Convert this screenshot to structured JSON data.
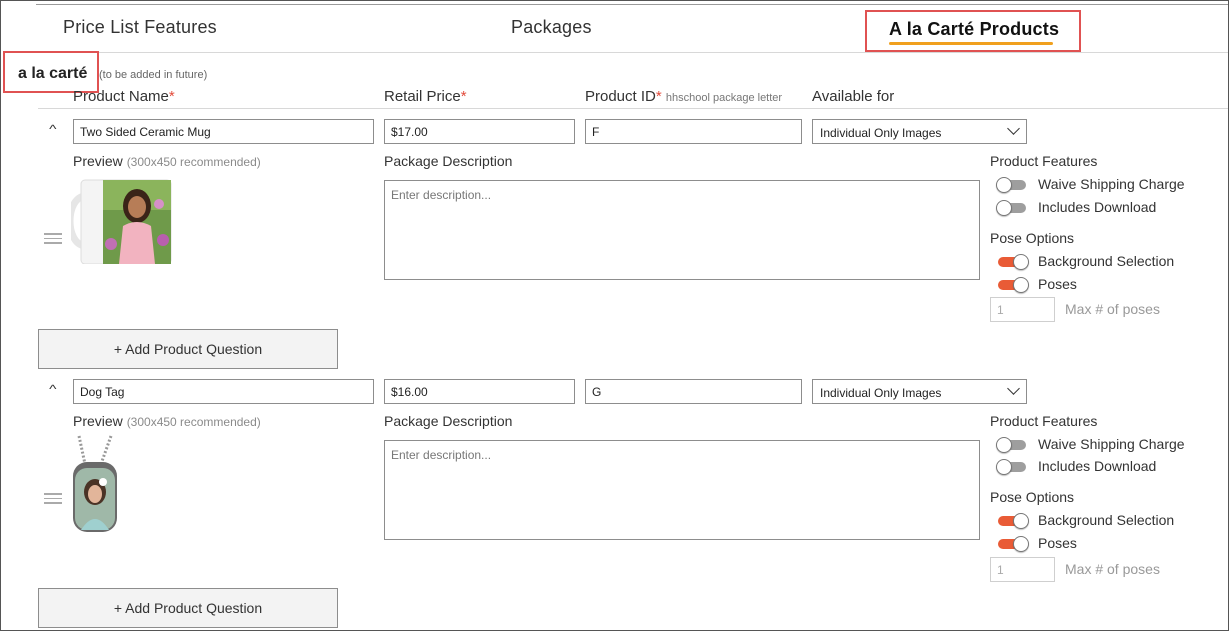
{
  "tabs": [
    {
      "label": "Price List Features"
    },
    {
      "label": "Packages"
    },
    {
      "label": "A la Carté Products"
    }
  ],
  "section": {
    "title": "a la carté",
    "note": "(to be added in future)"
  },
  "columns": {
    "product_name": "Product Name",
    "retail_price": "Retail Price",
    "product_id": "Product ID",
    "product_id_note": "hhschool package letter",
    "available_for": "Available for",
    "required_mark": "*"
  },
  "labels": {
    "preview": "Preview",
    "preview_note": "(300x450 recommended)",
    "package_description": "Package Description",
    "product_features": "Product Features",
    "pose_options": "Pose Options",
    "max_poses": "Max # of poses",
    "add_question": "+ Add Product Question"
  },
  "products": [
    {
      "name": "Two Sided Ceramic Mug",
      "price": "$17.00",
      "product_id": "F",
      "available_for": "Individual Only Images",
      "description_placeholder": "Enter description...",
      "features": [
        {
          "label": "Waive Shipping Charge",
          "on": false
        },
        {
          "label": "Includes Download",
          "on": false
        }
      ],
      "pose_options": [
        {
          "label": "Background Selection",
          "on": true
        },
        {
          "label": "Poses",
          "on": true
        }
      ],
      "max_poses": "1"
    },
    {
      "name": "Dog Tag",
      "price": "$16.00",
      "product_id": "G",
      "available_for": "Individual Only Images",
      "description_placeholder": "Enter description...",
      "features": [
        {
          "label": "Waive Shipping Charge",
          "on": false
        },
        {
          "label": "Includes Download",
          "on": false
        }
      ],
      "pose_options": [
        {
          "label": "Background Selection",
          "on": true
        },
        {
          "label": "Poses",
          "on": true
        }
      ],
      "max_poses": "1"
    }
  ],
  "colors": {
    "accent": "#e95b36",
    "highlight_box": "#e05252",
    "tab_underline": "#f0a01e"
  }
}
